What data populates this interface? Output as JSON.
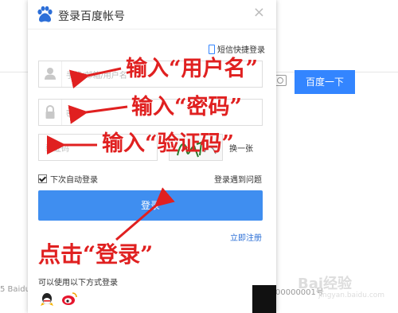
{
  "background": {
    "search_button_label": "百度一下",
    "footer_left": "5 Baidu",
    "footer_right": "00000001号"
  },
  "dialog": {
    "title": "登录百度帐号",
    "close_symbol": "×",
    "sms_login_link": "短信快捷登录",
    "username_placeholder": "手机/邮箱/用户名",
    "password_placeholder": "密码",
    "captcha_placeholder": "验证码",
    "captcha_refresh": "换一张",
    "remember_label": "下次自动登录",
    "trouble_link": "登录遇到问题",
    "login_button": "登录",
    "register_link": "立即注册",
    "other_methods": "可以使用以下方式登录"
  },
  "annotations": {
    "username": "输入“用户名”",
    "password": "输入“密码”",
    "captcha": "输入“验证码”",
    "login": "点击“登录”"
  },
  "watermark": {
    "brand": "Bai经验",
    "url": "jingyan.baidu.com"
  },
  "colors": {
    "accent": "#3f8ef0",
    "annotation": "#e02020"
  }
}
